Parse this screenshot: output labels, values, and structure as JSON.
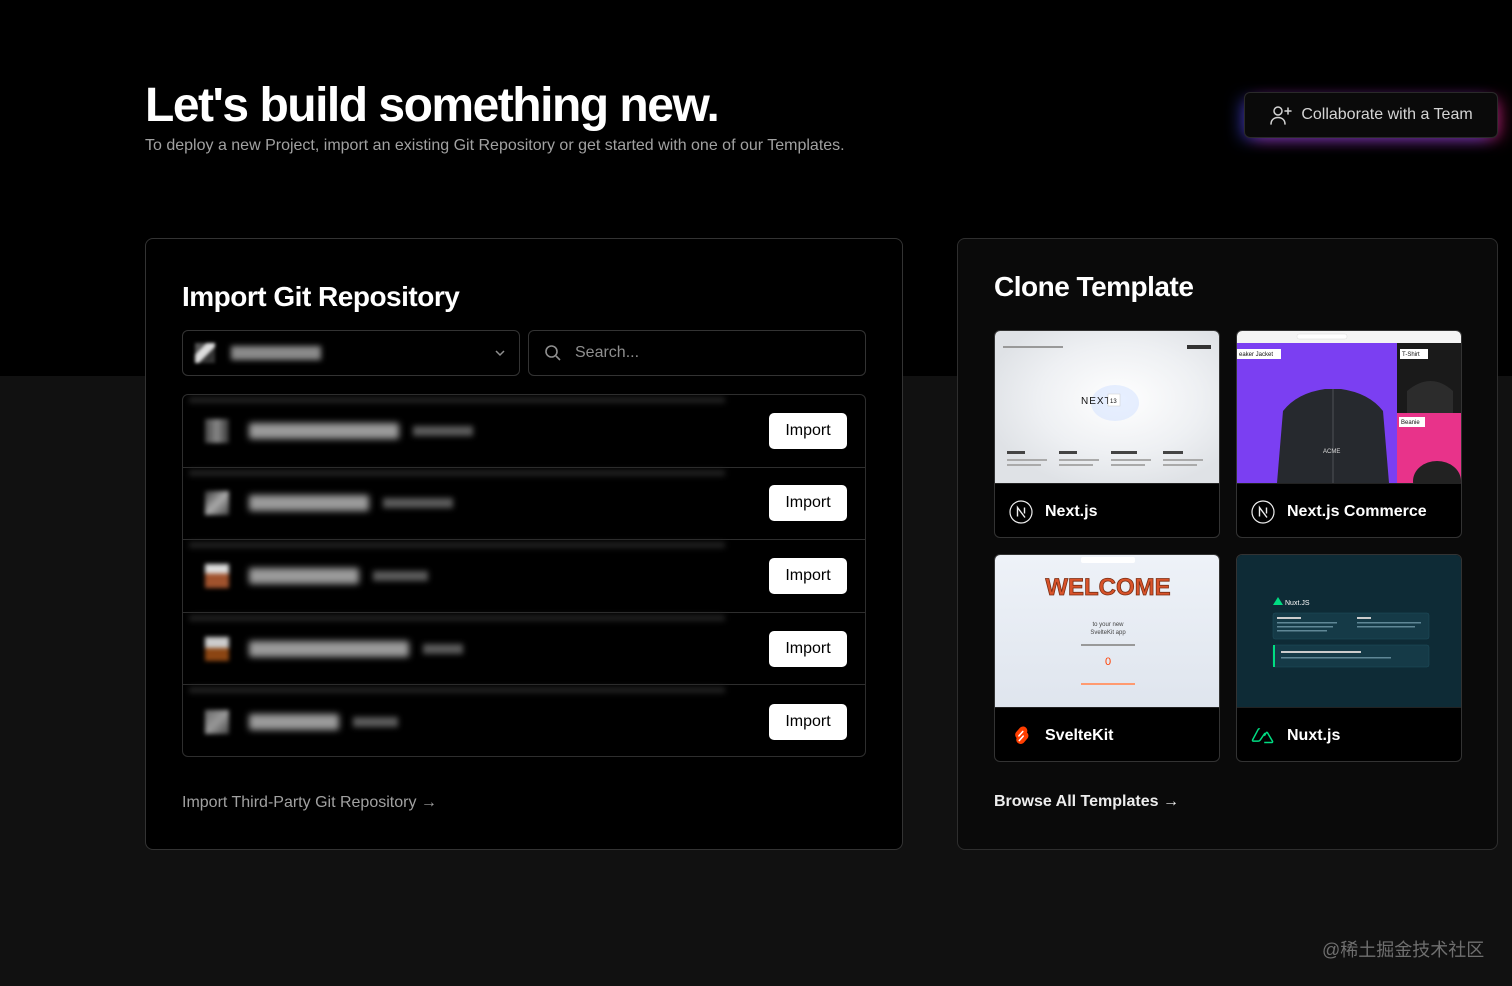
{
  "hero": {
    "title": "Let's build something new.",
    "subtitle": "To deploy a new Project, import an existing Git Repository or get started with one of our Templates."
  },
  "collaborate_button": {
    "label": "Collaborate with a Team",
    "icon": "user-plus-icon"
  },
  "import_card": {
    "title": "Import Git Repository",
    "search": {
      "placeholder": "Search...",
      "value": ""
    },
    "repos": [
      {
        "action_label": "Import"
      },
      {
        "action_label": "Import"
      },
      {
        "action_label": "Import"
      },
      {
        "action_label": "Import"
      },
      {
        "action_label": "Import"
      }
    ],
    "third_party_link": "Import Third-Party Git Repository →"
  },
  "clone_card": {
    "title": "Clone Template",
    "templates": [
      {
        "name": "Next.js",
        "logo": "nextjs-icon"
      },
      {
        "name": "Next.js Commerce",
        "logo": "nextjs-icon"
      },
      {
        "name": "SvelteKit",
        "logo": "svelte-icon"
      },
      {
        "name": "Nuxt.js",
        "logo": "nuxt-icon"
      }
    ],
    "browse_link": "Browse All Templates →"
  },
  "watermark": "@稀土掘金技术社区",
  "colors": {
    "background": "#111111",
    "hero_band": "#000000",
    "accent_blue": "#4650ff",
    "accent_pink": "#ff288c"
  }
}
